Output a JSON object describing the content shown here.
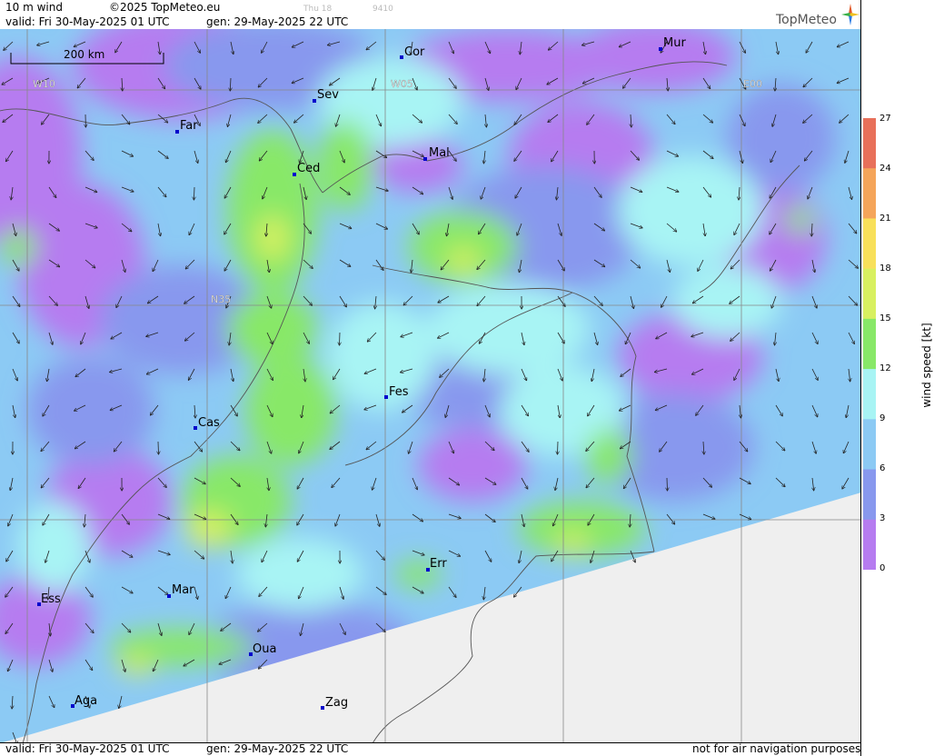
{
  "header": {
    "product": "10 m wind",
    "copyright": "©2025 TopMeteo.eu",
    "valid": "valid:  Fri  30-May-2025  01 UTC",
    "generated": "gen: 29-May-2025 22 UTC",
    "faint_left": "Thu 18",
    "faint_right": "9410",
    "logo": "TopMeteo"
  },
  "footer": {
    "valid": "valid:  Fri  30-May-2025  01 UTC",
    "generated": "gen: 29-May-2025 22 UTC",
    "disclaimer": "not for air navigation purposes"
  },
  "map": {
    "scale_label": "200 km",
    "grid_labels": [
      "W10",
      "W05",
      "E00",
      "N35"
    ],
    "cities": [
      "Cor",
      "Mur",
      "Sev",
      "Far",
      "Ced",
      "Mal",
      "Fes",
      "Cas",
      "Err",
      "Mar",
      "Ess",
      "Oua",
      "Aga",
      "Zag"
    ]
  },
  "legend": {
    "title": "wind speed [kt]",
    "ticks": [
      "27",
      "24",
      "21",
      "18",
      "15",
      "12",
      "9",
      "6",
      "3",
      "0"
    ],
    "colors": [
      "#e8705a",
      "#f5a55a",
      "#f8e05a",
      "#d8f060",
      "#88e868",
      "#a8f4f4",
      "#8ccaf4",
      "#8898ee",
      "#b67cf0"
    ]
  },
  "colors": {
    "no_data": "#efefef",
    "grid": "#888888",
    "city_marker": "#0000cc"
  }
}
